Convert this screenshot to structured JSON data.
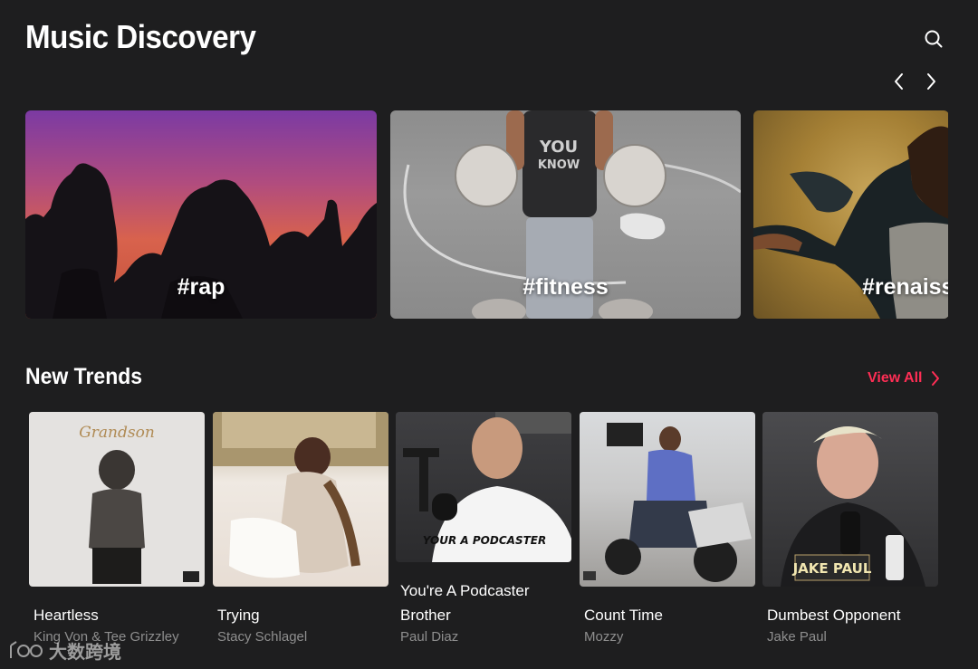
{
  "header": {
    "title": "Music Discovery",
    "search_icon": "search-icon"
  },
  "carousel": {
    "prev_icon": "chevron-left-icon",
    "next_icon": "chevron-right-icon",
    "tiles": [
      {
        "label": "#rap"
      },
      {
        "label": "#fitness"
      },
      {
        "label": "#renaiss"
      }
    ]
  },
  "trends": {
    "title": "New Trends",
    "view_all_label": "View All",
    "accent_color": "#ff2e55",
    "cards": [
      {
        "title": "Heartless",
        "artist": "King Von & Tee Grizzley",
        "art_text": "Grandson"
      },
      {
        "title": "Trying",
        "artist": "Stacy Schlagel"
      },
      {
        "title": "You're A Podcaster Brother",
        "artist": "Paul Diaz",
        "art_text": "YOUR A PODCASTER"
      },
      {
        "title": "Count Time",
        "artist": "Mozzy"
      },
      {
        "title": "Dumbest Opponent",
        "artist": "Jake Paul",
        "art_text": "JAKE PAUL"
      }
    ]
  },
  "watermark": {
    "text": "大数跨境"
  }
}
